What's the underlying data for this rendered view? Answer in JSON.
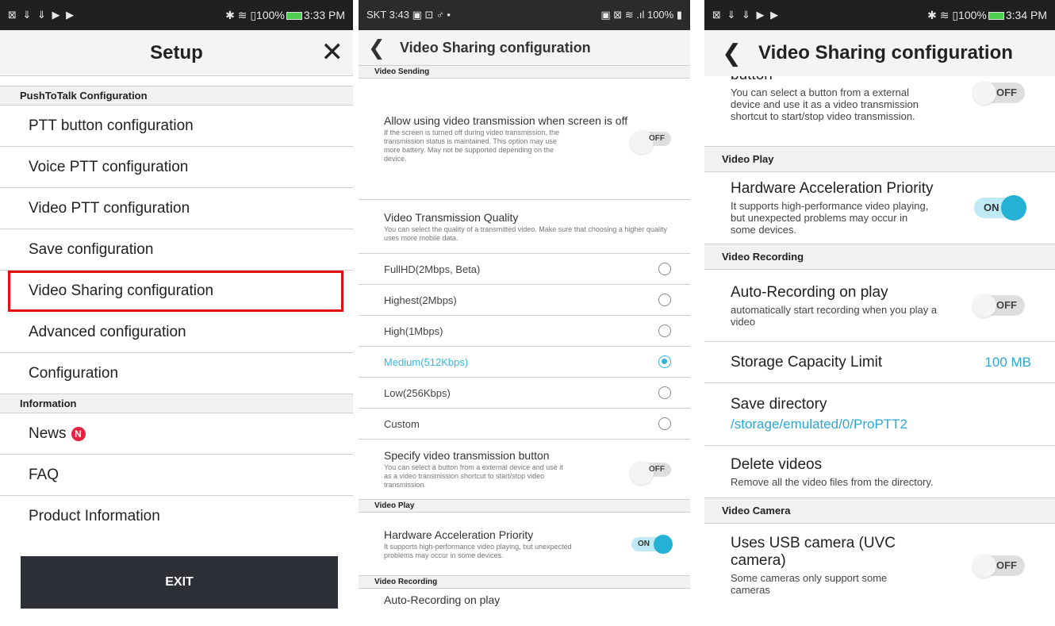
{
  "panel1": {
    "status": {
      "left_icons": "⊠ ⇓ ⇓ ▶ ▶",
      "right": "✱ ≋ ▯100%",
      "time": "3:33 PM"
    },
    "title": "Setup",
    "close_glyph": "✕",
    "section_ptt": "PushToTalk Configuration",
    "items": [
      "PTT button configuration",
      "Voice PTT configuration",
      "Video PTT configuration",
      "Save configuration",
      "Video Sharing configuration",
      "Advanced configuration",
      "Configuration"
    ],
    "section_info": "Information",
    "info_items": {
      "news": "News",
      "news_badge": "N",
      "faq": "FAQ",
      "product": "Product Information"
    },
    "exit": "EXIT",
    "highlight_color": "#e01010"
  },
  "panel2": {
    "status": {
      "left": "SKT 3:43 ▣ ⊡ ♂ •",
      "right": "▣ ⊠ ≋ .ıl 100% ▮"
    },
    "back_glyph": "❮",
    "title": "Video Sharing configuration",
    "section_sending": "Video Sending",
    "allow": {
      "title": "Allow using video transmission when screen is off",
      "sub": "If the screen is turned off during video transmission, the transmission status is maintained. This option may use more battery. May not be supported depending on the device.",
      "toggle": "OFF"
    },
    "quality": {
      "title": "Video Transmission Quality",
      "sub": "You can select the quality of a transmitted video. Make sure that choosing a higher quality uses more mobile data."
    },
    "options": [
      {
        "label": "FullHD(2Mbps, Beta)",
        "selected": false
      },
      {
        "label": "Highest(2Mbps)",
        "selected": false
      },
      {
        "label": "High(1Mbps)",
        "selected": false
      },
      {
        "label": "Medium(512Kbps)",
        "selected": true
      },
      {
        "label": "Low(256Kbps)",
        "selected": false
      },
      {
        "label": "Custom",
        "selected": false
      }
    ],
    "specify": {
      "title": "Specify video transmission button",
      "sub": "You can select a button from a external device and use it as a video transmission shortcut to start/stop video transmission.",
      "toggle": "OFF"
    },
    "section_play": "Video Play",
    "hw": {
      "title": "Hardware Acceleration Priority",
      "sub": "It supports high-performance video playing, but unexpected problems may occur in some devices.",
      "toggle": "ON"
    },
    "section_rec": "Video Recording",
    "auto_title": "Auto-Recording on play"
  },
  "panel3": {
    "status": {
      "left_icons": "⊠ ⇓ ⇓ ▶ ▶",
      "right": "✱ ≋ ▯100%",
      "time": "3:34 PM"
    },
    "back_glyph": "❮",
    "title": "Video Sharing configuration",
    "button_cut": "button",
    "button_sub": "You can select a button from a external device and use it as a video transmission shortcut to start/stop video transmission.",
    "button_toggle": "OFF",
    "section_play": "Video Play",
    "hw": {
      "title": "Hardware Acceleration Priority",
      "sub": "It supports high-performance video playing, but unexpected problems may occur in some devices.",
      "toggle": "ON"
    },
    "section_rec": "Video Recording",
    "auto": {
      "title": "Auto-Recording on play",
      "sub": "automatically start recording when you play a video",
      "toggle": "OFF"
    },
    "storage": {
      "title": "Storage Capacity Limit",
      "value": "100 MB"
    },
    "save_dir": {
      "title": "Save directory",
      "path": "/storage/emulated/0/ProPTT2"
    },
    "delete": {
      "title": "Delete videos",
      "sub": "Remove all the video files from the directory."
    },
    "section_camera": "Video Camera",
    "usb": {
      "title": "Uses USB camera (UVC camera)",
      "sub": "Some cameras only support some cameras",
      "toggle": "OFF"
    },
    "accent_color": "#2aa8d3"
  }
}
